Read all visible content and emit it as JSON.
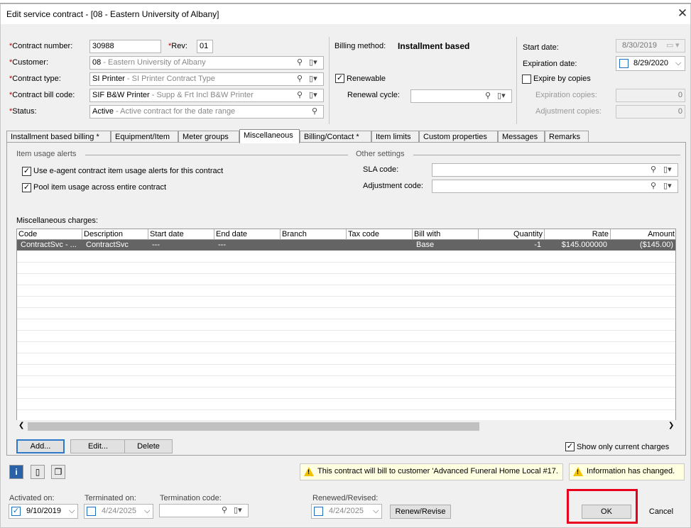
{
  "window": {
    "title": "Edit service contract - [08 - Eastern University of Albany]",
    "close_glyph": "✕"
  },
  "header": {
    "contract_number": {
      "label": "Contract number:",
      "value": "30988"
    },
    "rev": {
      "label": "Rev:",
      "value": "01"
    },
    "customer": {
      "label": "Customer:",
      "code": "08",
      "desc": "- Eastern University of Albany"
    },
    "contract_type": {
      "label": "Contract type:",
      "code": "SI Printer",
      "desc": "- SI Printer Contract Type"
    },
    "contract_bill_code": {
      "label": "Contract bill code:",
      "code": "SIF B&W Printer",
      "desc": "- Supp & Frt Incl B&W Printer"
    },
    "status": {
      "label": "Status:",
      "code": "Active",
      "desc": "- Active contract for the date range"
    },
    "billing_method": {
      "label": "Billing method:",
      "value": "Installment based"
    },
    "renewable": {
      "label": "Renewable",
      "checked": true
    },
    "renewal_cycle": {
      "label": "Renewal cycle:",
      "value": ""
    },
    "start_date": {
      "label": "Start date:",
      "value": "8/30/2019"
    },
    "expiration_date": {
      "label": "Expiration date:",
      "value": "8/29/2020"
    },
    "expire_by_copies": {
      "label": "Expire by copies",
      "checked": false
    },
    "expiration_copies": {
      "label": "Expiration copies:",
      "value": "0"
    },
    "adjustment_copies": {
      "label": "Adjustment copies:",
      "value": "0"
    }
  },
  "tabs": [
    "Installment based billing *",
    "Equipment/Item",
    "Meter groups",
    "Miscellaneous",
    "Billing/Contact *",
    "Item limits",
    "Custom properties",
    "Messages",
    "Remarks"
  ],
  "misc": {
    "item_usage_alerts": {
      "title": "Item usage alerts",
      "use_eagent": "Use e-agent contract item usage alerts for this contract",
      "pool_usage": "Pool item usage across entire contract"
    },
    "other_settings": {
      "title": "Other settings",
      "sla_code": "SLA code:",
      "adjustment_code": "Adjustment code:"
    },
    "charges_label": "Miscellaneous charges:",
    "columns": [
      "Code",
      "Description",
      "Start date",
      "End date",
      "Branch",
      "Tax code",
      "Bill with",
      "Quantity",
      "Rate",
      "Amount"
    ],
    "rows": [
      {
        "code": "ContractSvc - ...",
        "description": "ContractSvc",
        "start_date": "---",
        "end_date": "---",
        "branch": "",
        "tax_code": "",
        "bill_with": "Base",
        "quantity": "-1",
        "rate": "$145.000000",
        "amount": "($145.00)"
      }
    ],
    "buttons": {
      "add": "Add...",
      "edit": "Edit...",
      "delete": "Delete"
    },
    "show_only_current": "Show only current charges"
  },
  "warnings": {
    "bill_to": "This contract will bill to customer 'Advanced Funeral Home Local #17.",
    "changed": "Information has changed."
  },
  "footer": {
    "activated_on": {
      "label": "Activated on:",
      "value": "9/10/2019",
      "checked": true
    },
    "terminated_on": {
      "label": "Terminated on:",
      "value": "4/24/2025",
      "checked": false
    },
    "termination_code": {
      "label": "Termination code:",
      "value": ""
    },
    "renewed_revised": {
      "label": "Renewed/Revised:",
      "value": "4/24/2025",
      "checked": false
    },
    "renew_revise_button": "Renew/Revise",
    "ok": "OK",
    "cancel": "Cancel"
  },
  "glyphs": {
    "lookup": "⚲",
    "menu": "▾",
    "chevron_down": "⌵",
    "check": "✓",
    "scroll_left": "❮",
    "scroll_right": "❯"
  }
}
